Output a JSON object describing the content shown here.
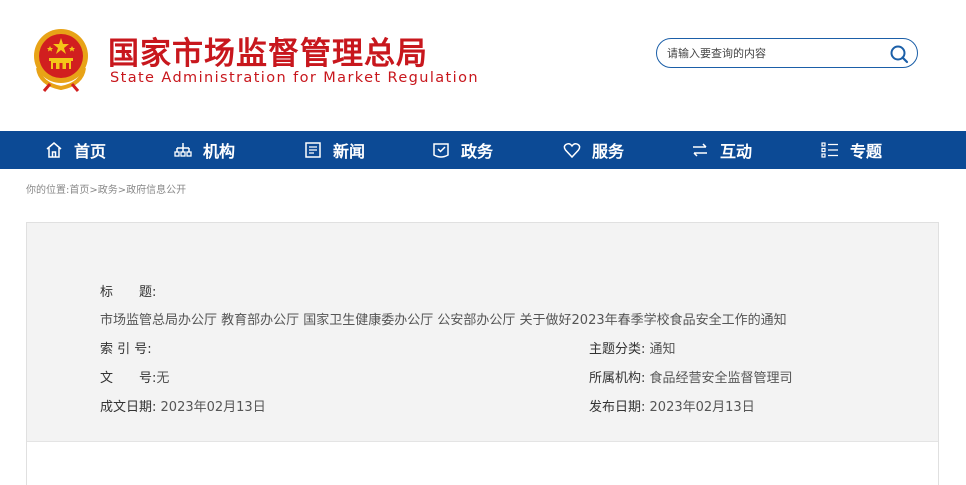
{
  "header": {
    "title_cn": "国家市场监督管理总局",
    "title_en": "State Administration for Market Regulation",
    "brand_color": "#c8171d"
  },
  "search": {
    "placeholder": "请输入要查询的内容",
    "value": ""
  },
  "nav": {
    "color": "#0c4a95",
    "items": [
      {
        "label": "首页",
        "icon": "home-icon"
      },
      {
        "label": "机构",
        "icon": "org-chart-icon"
      },
      {
        "label": "新闻",
        "icon": "newspaper-icon"
      },
      {
        "label": "政务",
        "icon": "government-affairs-icon"
      },
      {
        "label": "服务",
        "icon": "heart-icon"
      },
      {
        "label": "互动",
        "icon": "exchange-arrows-icon"
      },
      {
        "label": "专题",
        "icon": "topic-list-icon"
      }
    ]
  },
  "breadcrumb": {
    "prefix": "你的位置:",
    "items": [
      "首页",
      "政务",
      "政府信息公开"
    ],
    "separator": ">"
  },
  "doc_info": {
    "title_label": "标　　题:",
    "title_value": "市场监管总局办公厅 教育部办公厅 国家卫生健康委办公厅 公安部办公厅 关于做好2023年春季学校食品安全工作的通知",
    "index_label": "索 引 号:",
    "index_value": "",
    "category_label": "主题分类:",
    "category_value": "通知",
    "docno_label": "文　　号:",
    "docno_value": "无",
    "agency_label": "所属机构:",
    "agency_value": "食品经营安全监督管理司",
    "created_label": "成文日期:",
    "created_value": "2023年02月13日",
    "published_label": "发布日期:",
    "published_value": "2023年02月13日"
  }
}
